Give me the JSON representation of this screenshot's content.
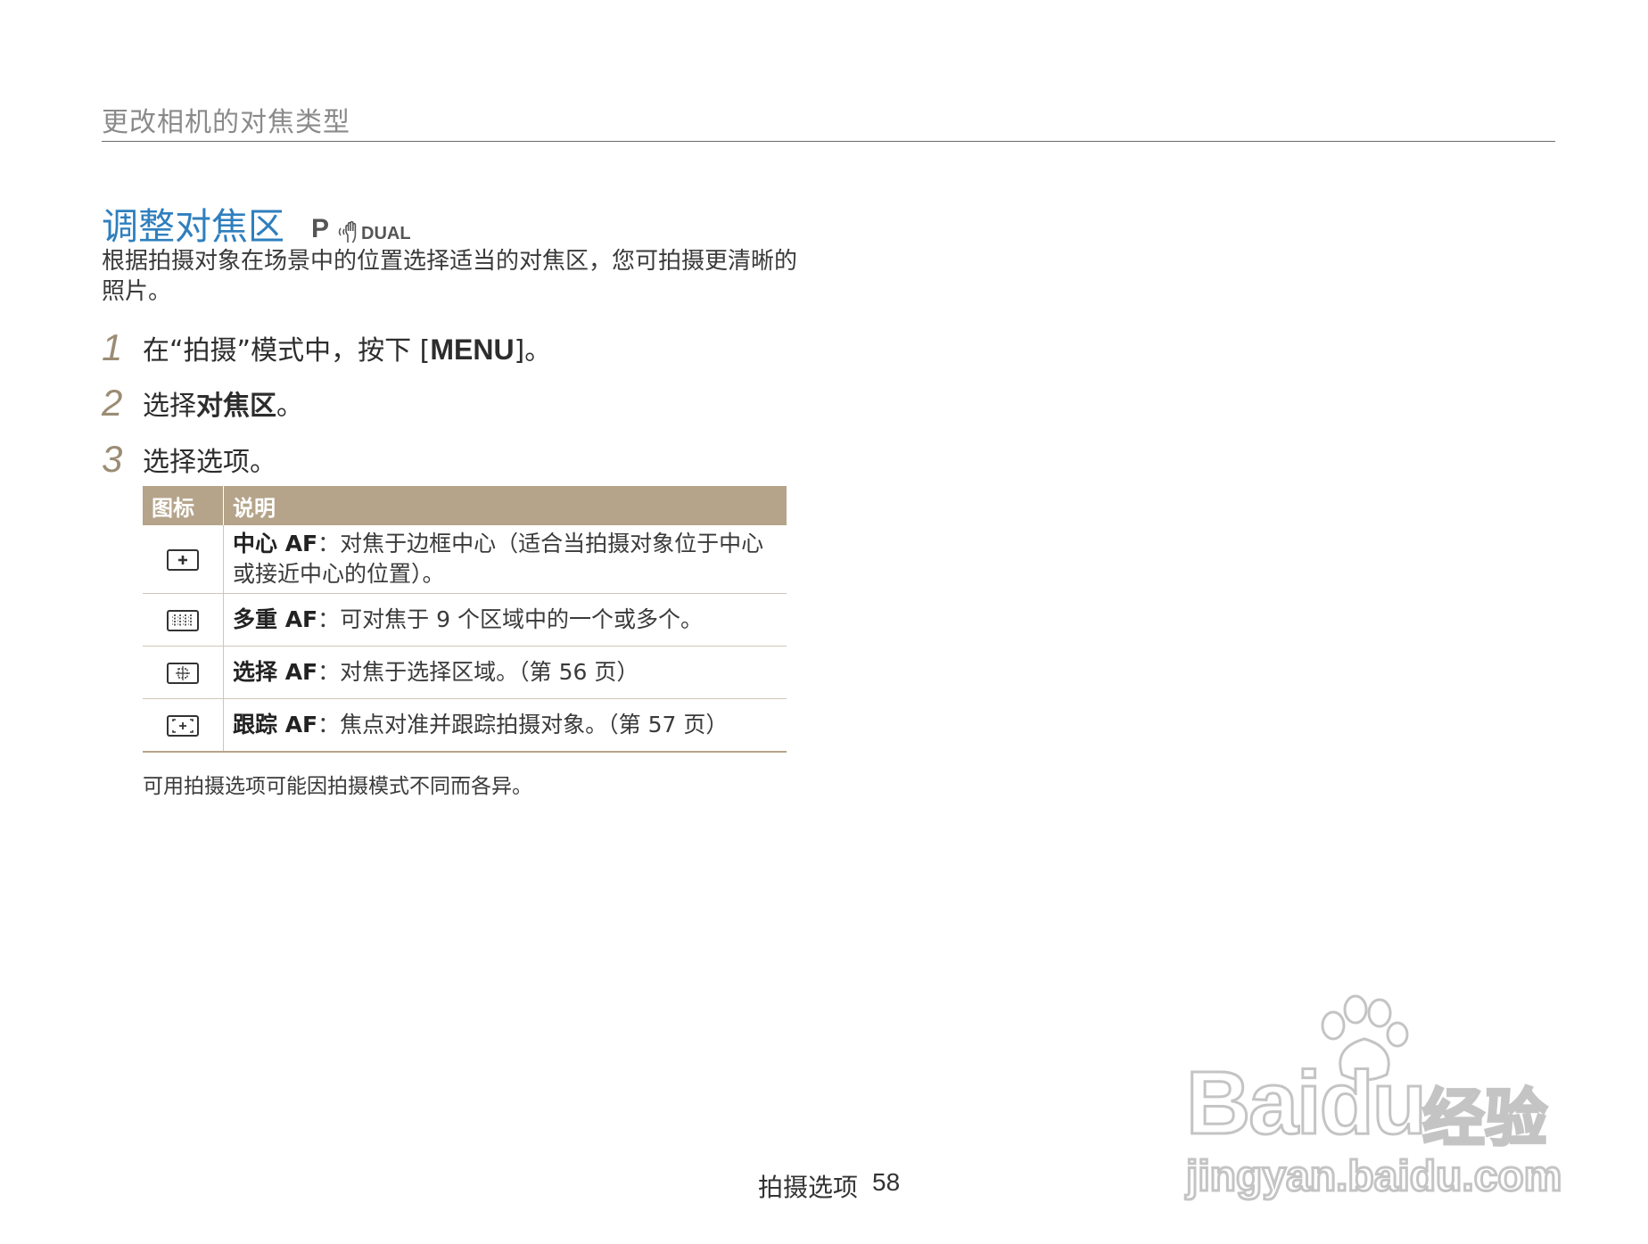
{
  "chapter": {
    "title": "更改相机的对焦类型"
  },
  "section": {
    "title": "调整对焦区",
    "mode_p": "P",
    "mode_dual": "DUAL",
    "mode_dual_icon": "hand-shake-icon"
  },
  "intro": "根据拍摄对象在场景中的位置选择适当的对焦区，您可拍摄更清晰的照片。",
  "steps": [
    {
      "num": "1",
      "pre": "在“拍摄”模式中，按下 [",
      "key": "MENU",
      "post": "]。"
    },
    {
      "num": "2",
      "pre": "选择",
      "bold": "对焦区",
      "post": "。"
    },
    {
      "num": "3",
      "text": "选择选项。"
    }
  ],
  "table": {
    "headers": [
      "图标",
      "说明"
    ],
    "rows": [
      {
        "icon": "center-af-icon",
        "name": "中心 AF",
        "desc": "：对焦于边框中心（适合当拍摄对象位于中心或接近中心的位置）。"
      },
      {
        "icon": "multi-af-icon",
        "name": "多重 AF",
        "desc": "：可对焦于 9 个区域中的一个或多个。"
      },
      {
        "icon": "selection-af-icon",
        "name": "选择 AF",
        "desc": "：对焦于选择区域。（第 56 页）"
      },
      {
        "icon": "tracking-af-icon",
        "name": "跟踪 AF",
        "desc": "：焦点对准并跟踪拍摄对象。（第 57 页）"
      }
    ]
  },
  "note": "可用拍摄选项可能因拍摄模式不同而各异。",
  "footer": {
    "section": "拍摄选项",
    "page": "58"
  },
  "watermark": {
    "brand": "Baidu",
    "cn": "经验",
    "url": "jingyan.baidu.com"
  },
  "colors": {
    "title_blue": "#2f7fbe",
    "table_header": "#b5a48a",
    "step_num": "#9b8c74"
  }
}
